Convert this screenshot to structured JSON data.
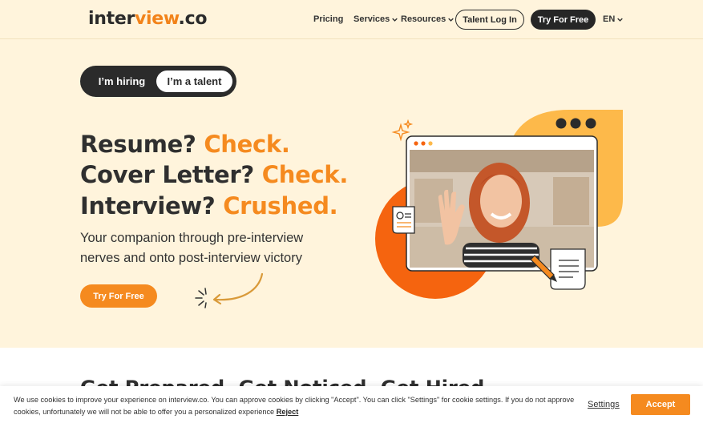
{
  "brand": {
    "logo_part1": "inter",
    "logo_part2": "view",
    "logo_part3": ".co"
  },
  "nav": {
    "pricing": "Pricing",
    "services": "Services",
    "resources": "Resources",
    "talent_login": "Talent Log In",
    "try_free": "Try For Free",
    "language": "EN"
  },
  "toggle": {
    "hiring": "I’m hiring",
    "talent": "I’m a talent",
    "selected": "I’m a talent"
  },
  "hero": {
    "line1_a": "Resume? ",
    "line1_b": "Check.",
    "line2_a": "Cover Letter? ",
    "line2_b": "Check.",
    "line3_a": "Interview? ",
    "line3_b": "Crushed.",
    "subtitle": "Your companion through pre-interview nerves and onto post-interview victory",
    "cta": "Try For Free"
  },
  "section": {
    "title": "Get Prepared. Get Noticed. Get Hired."
  },
  "cookie": {
    "text": "We use cookies to improve your experience on interview.co. You can approve cookies by clicking \"Accept\". You can click \"Settings\" for cookie settings. If you do not approve cookies, unfortunately we will not be able to offer you a personalized experience",
    "reject": "Reject",
    "settings": "Settings",
    "accept": "Accept"
  },
  "colors": {
    "accent": "#f58a1f",
    "background": "#fff4dc",
    "dark": "#262626",
    "yellow": "#fdb94a",
    "deep_orange": "#f5640f"
  },
  "icons": [
    "chevron-down-icon",
    "sparkle-icon",
    "resume-icon",
    "pen-icon",
    "document-icon",
    "arrow-icon",
    "window-dots-icon"
  ]
}
